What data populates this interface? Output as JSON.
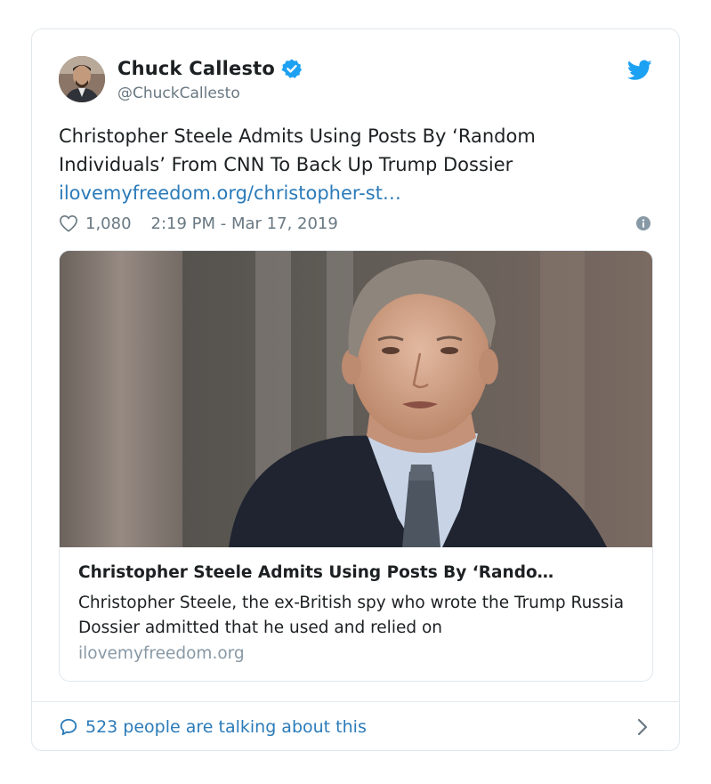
{
  "author": {
    "display_name": "Chuck Callesto",
    "handle": "@ChuckCallesto",
    "verified": true
  },
  "tweet": {
    "text": "Christopher Steele Admits Using Posts By ‘Random Individuals’ From CNN To Back Up Trump Dossier",
    "link_text": "ilovemyfreedom.org/christopher-st…",
    "likes": "1,080",
    "timestamp": "2:19 PM - Mar 17, 2019"
  },
  "card": {
    "title": "Christopher Steele Admits Using Posts By ‘Rando…",
    "description": "Christopher Steele, the ex-British spy who wrote the Trump Russia Dossier admitted that he used and relied on",
    "domain": "ilovemyfreedom.org"
  },
  "footer": {
    "talking_text": "523 people are talking about this"
  },
  "colors": {
    "link_blue": "#2b7bb9",
    "twitter_blue": "#1da1f2",
    "muted": "#697882"
  }
}
